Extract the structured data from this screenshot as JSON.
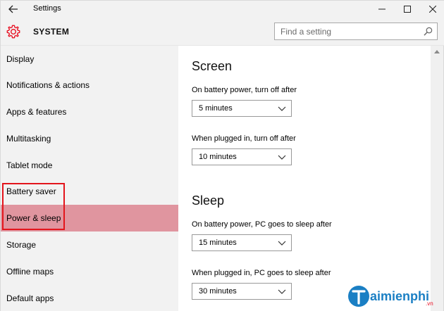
{
  "window": {
    "title": "Settings",
    "back_icon": "back-arrow-icon",
    "minimize_icon": "minimize-icon",
    "maximize_icon": "maximize-icon",
    "close_icon": "close-icon"
  },
  "header": {
    "icon": "gear-icon",
    "title": "SYSTEM",
    "search": {
      "placeholder": "Find a setting",
      "value": "",
      "icon": "search-icon"
    }
  },
  "sidebar": {
    "items": [
      {
        "label": "Display",
        "active": false
      },
      {
        "label": "Notifications & actions",
        "active": false
      },
      {
        "label": "Apps & features",
        "active": false
      },
      {
        "label": "Multitasking",
        "active": false
      },
      {
        "label": "Tablet mode",
        "active": false
      },
      {
        "label": "Battery saver",
        "active": false
      },
      {
        "label": "Power & sleep",
        "active": true
      },
      {
        "label": "Storage",
        "active": false
      },
      {
        "label": "Offline maps",
        "active": false
      },
      {
        "label": "Default apps",
        "active": false
      }
    ]
  },
  "main": {
    "screen": {
      "title": "Screen",
      "battery_label": "On battery power, turn off after",
      "battery_value": "5 minutes",
      "plugged_label": "When plugged in, turn off after",
      "plugged_value": "10 minutes"
    },
    "sleep": {
      "title": "Sleep",
      "battery_label": "On battery power, PC goes to sleep after",
      "battery_value": "15 minutes",
      "plugged_label": "When plugged in, PC goes to sleep after",
      "plugged_value": "30 minutes"
    }
  },
  "watermark": {
    "text": "aimienphi",
    "suffix": ".vn"
  },
  "colors": {
    "accent": "#e81123",
    "active_item": "#e0959f",
    "highlight_box": "#e3151c",
    "sidebar_bg": "#f2f2f2",
    "logo_blue": "#1a7fc4"
  }
}
